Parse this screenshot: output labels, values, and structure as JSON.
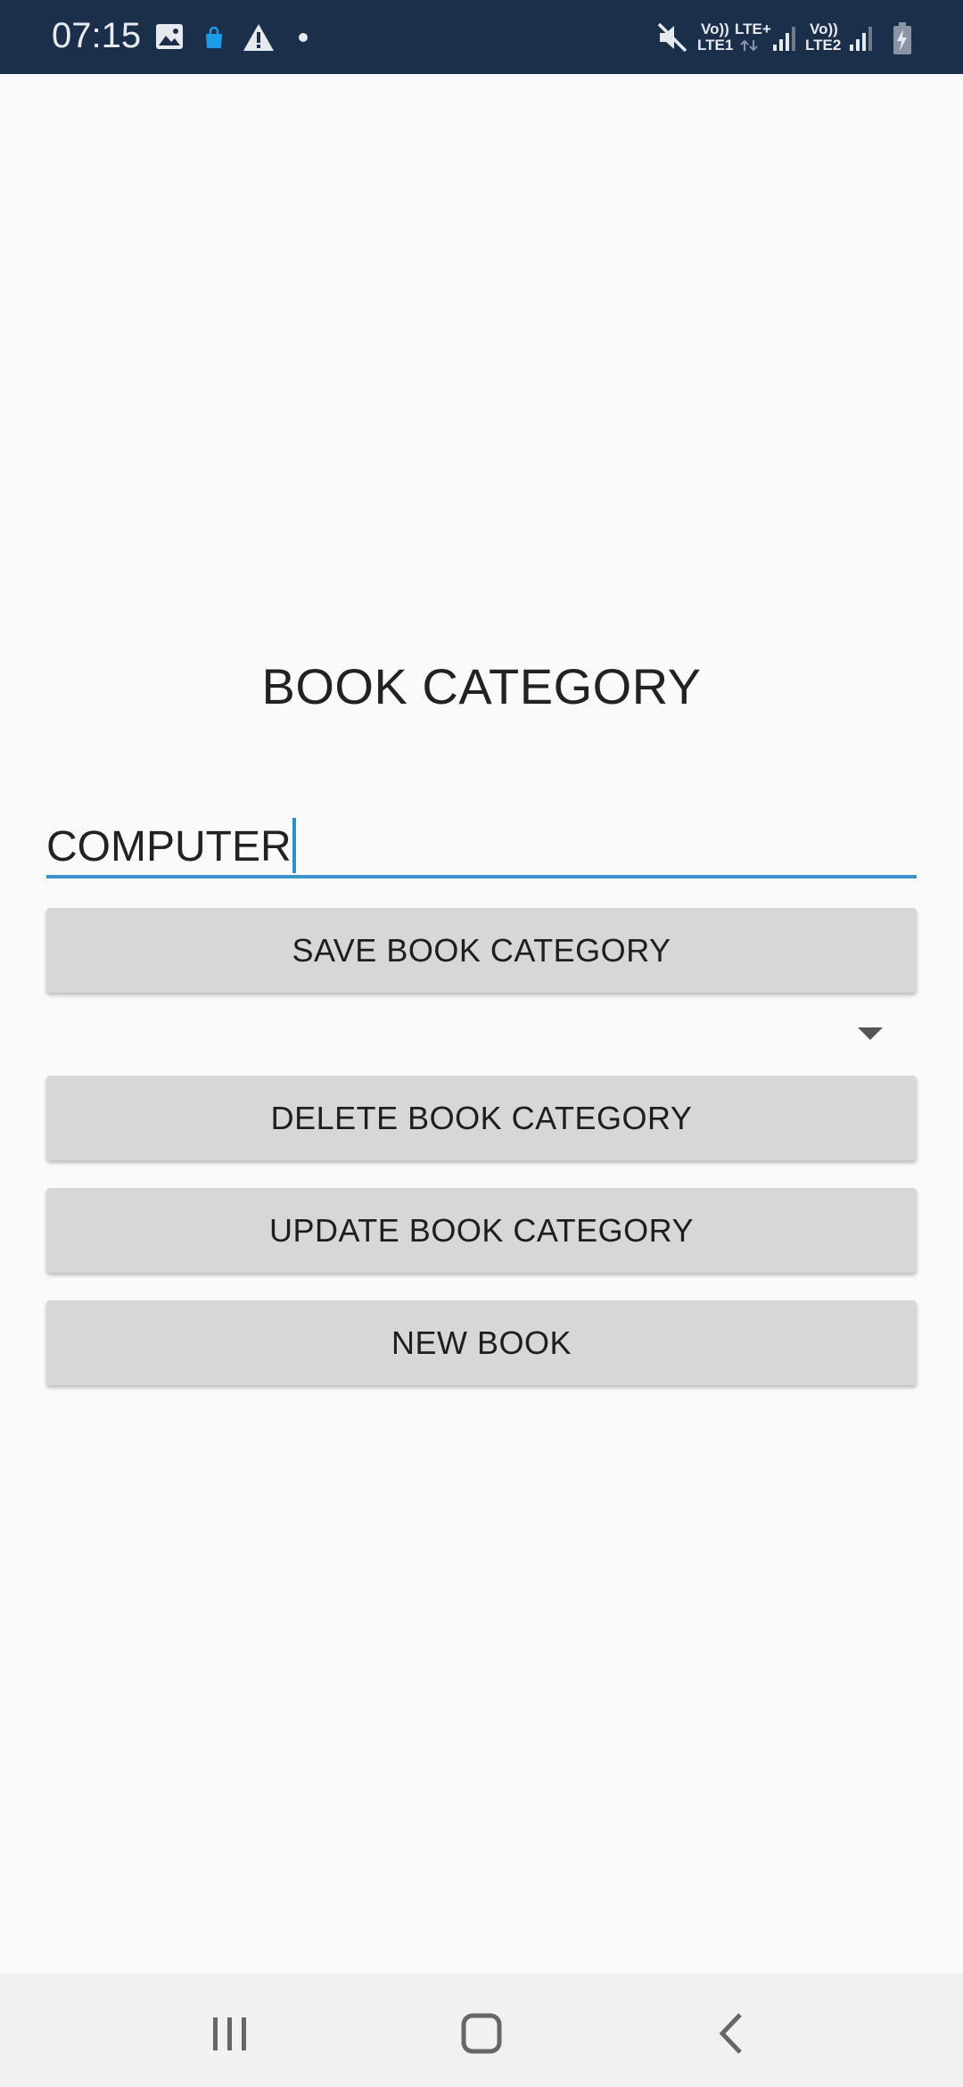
{
  "status_bar": {
    "time": "07:15",
    "icons": [
      "image-icon",
      "shopping-bag-icon",
      "warning-icon",
      "dot-icon",
      "mute-icon",
      "signal-icon",
      "battery-charging-icon"
    ],
    "volte1": "Vo))",
    "lte1": "LTE1",
    "lte_plus": "LTE+",
    "volte2": "Vo))",
    "lte2": "LTE2"
  },
  "page": {
    "title": "BOOK CATEGORY"
  },
  "category_input": {
    "value": "COMPUTER"
  },
  "buttons": {
    "save": "SAVE BOOK CATEGORY",
    "delete": "DELETE BOOK CATEGORY",
    "update": "UPDATE BOOK CATEGORY",
    "new_book": "NEW BOOK"
  },
  "category_spinner": {
    "selected": ""
  },
  "nav_bar": {
    "icons": [
      "recent-apps-icon",
      "home-icon",
      "back-icon"
    ]
  },
  "colors": {
    "status_bar": "#1b2f4a",
    "accent": "#3a93c9",
    "button": "#d6d7d7",
    "background": "#fafafa"
  }
}
